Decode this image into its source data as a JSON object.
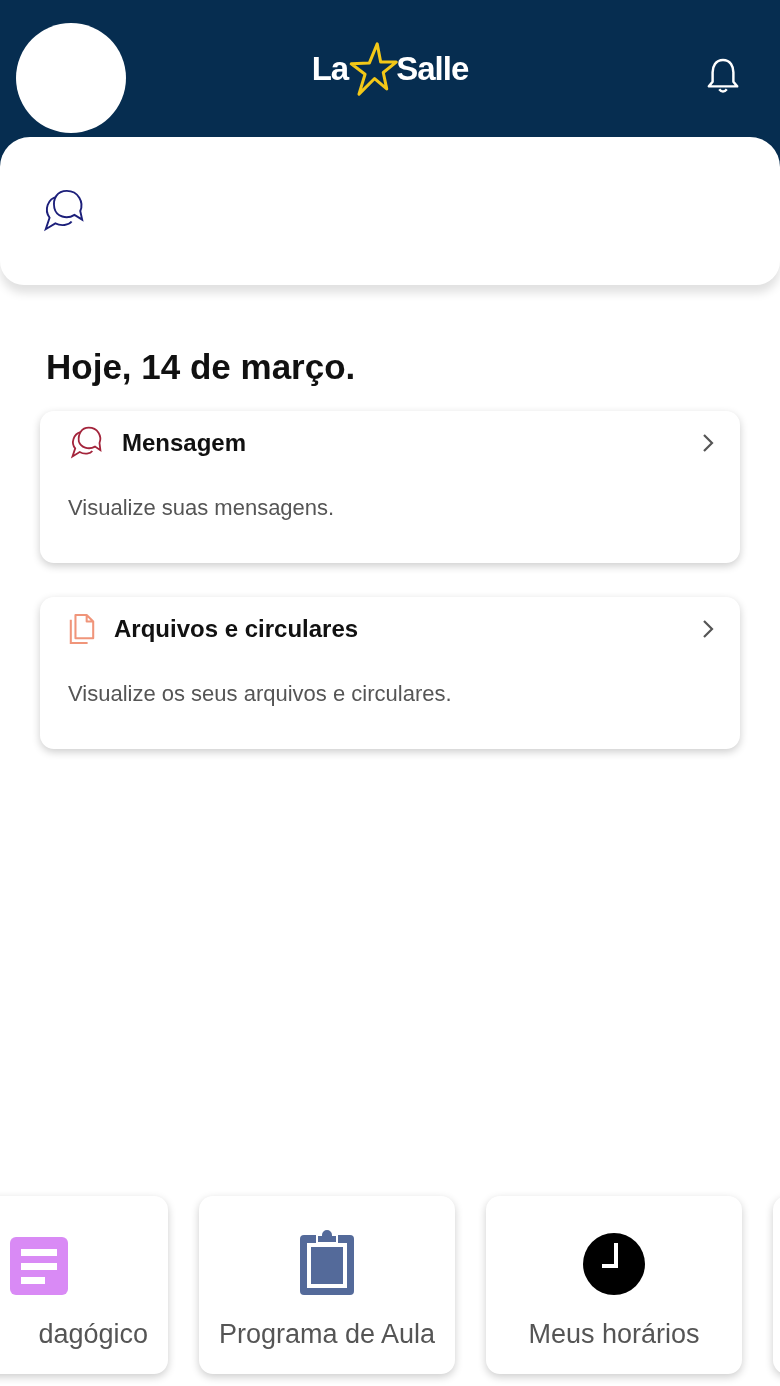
{
  "header": {
    "logo": {
      "left": "La",
      "right": "Salle"
    }
  },
  "date_heading": "Hoje, 14 de março.",
  "cards": [
    {
      "kind": "message",
      "title": "Mensagem",
      "subtitle": "Visualize suas mensagens."
    },
    {
      "kind": "files",
      "title": "Arquivos e circulares",
      "subtitle": "Visualize os seus arquivos e circulares."
    }
  ],
  "shortcuts": [
    {
      "kind": "document",
      "label": "dagógico"
    },
    {
      "kind": "clipboard",
      "label": "Programa de Aula"
    },
    {
      "kind": "clock",
      "label": "Meus horários"
    }
  ]
}
